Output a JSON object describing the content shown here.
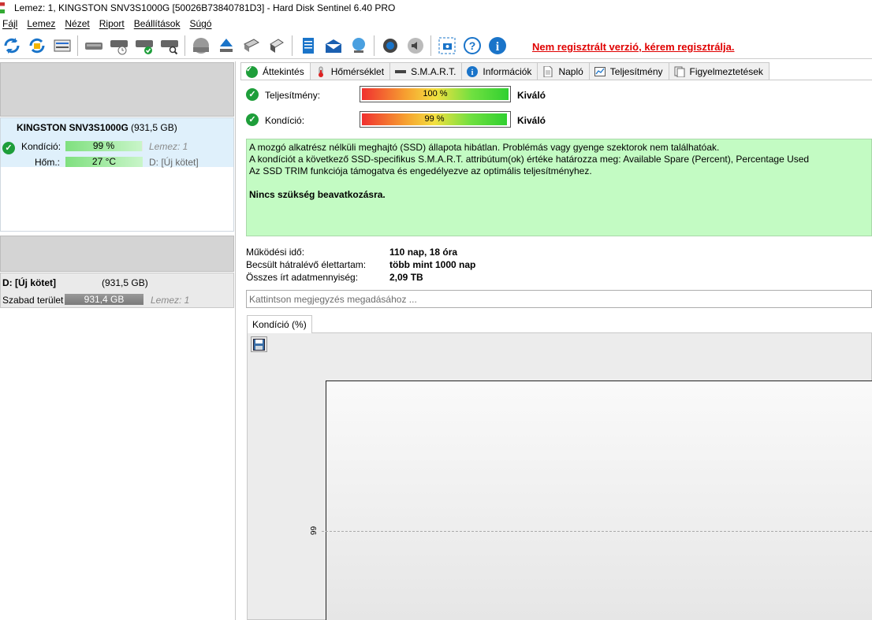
{
  "window": {
    "title": "Lemez: 1, KINGSTON SNV3S1000G [50026B73840781D3]  -  Hard Disk Sentinel 6.40 PRO"
  },
  "menu": [
    "Fájl",
    "Lemez",
    "Nézet",
    "Riport",
    "Beállítások",
    "Súgó"
  ],
  "toolbar": {
    "icons": [
      "refresh-icon",
      "refresh-all-icon",
      "disk-list-icon",
      "disk-icon",
      "disk-schedule-icon",
      "disk-check-icon",
      "disk-search-icon",
      "disk-surface-icon",
      "eject-icon",
      "usb-drive-icon",
      "disk-info-icon",
      "report-icon",
      "mail-icon",
      "network-icon",
      "settings-icon",
      "sound-icon",
      "screenshot-icon",
      "help-icon",
      "about-icon"
    ],
    "unregistered": "Nem regisztrált verzió, kérem regisztrálja."
  },
  "left": {
    "disk": {
      "name": "KINGSTON SNV3S1000G",
      "size": "(931,5 GB)",
      "cond_label": "Kondíció:",
      "cond_value": "99 %",
      "cond_pct": 99,
      "disk_ref": "Lemez: 1",
      "temp_label": "Hőm.:",
      "temp_value": "27 °C",
      "vol_ref": "D: [Új kötet]"
    },
    "volume": {
      "name": "D: [Új kötet]",
      "size": "(931,5 GB)",
      "free_label": "Szabad terület",
      "free_value": "931,4 GB",
      "disk_ref": "Lemez: 1"
    }
  },
  "tabs": [
    "Áttekintés",
    "Hőmérséklet",
    "S.M.A.R.T.",
    "Információk",
    "Napló",
    "Teljesítmény",
    "Figyelmeztetések"
  ],
  "overview": {
    "perf_label": "Teljesítmény:",
    "perf_value": "100 %",
    "perf_pct": 100,
    "perf_rating": "Kiváló",
    "cond_label": "Kondíció:",
    "cond_value": "99 %",
    "cond_pct": 99,
    "cond_rating": "Kiváló",
    "info_lines": [
      "A mozgó alkatrész nélküli meghajtó (SSD) állapota hibátlan. Problémás vagy gyenge szektorok nem találhatóak.",
      "A kondíciót a következő SSD-specifikus S.M.A.R.T. attribútum(ok) értéke határozza meg:  Available Spare (Percent), Percentage Used",
      "Az SSD TRIM funkciója támogatva és engedélyezve az optimális teljesítményhez."
    ],
    "info_bold": "Nincs szükség beavatkozásra.",
    "uptime_label": "Működési idő:",
    "uptime_value": "110 nap, 18 óra",
    "life_label": "Becsült hátralévő élettartam:",
    "life_value": "több mint 1000 nap",
    "written_label": "Összes írt adatmennyiség:",
    "written_value": "2,09 TB",
    "note_placeholder": "Kattintson megjegyzés megadásához ..."
  },
  "chart_tab": "Kondíció  (%)",
  "chart_data": {
    "type": "line",
    "title": "",
    "ylabel": "",
    "ytick": "99",
    "series": []
  }
}
